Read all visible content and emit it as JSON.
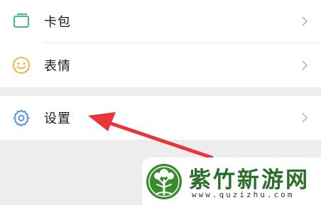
{
  "menu": {
    "items": [
      {
        "label": "卡包",
        "icon": "card-wallet-icon"
      },
      {
        "label": "表情",
        "icon": "smiley-icon"
      },
      {
        "label": "设置",
        "icon": "gear-icon"
      }
    ]
  },
  "annotation": {
    "arrow_color": "#e8353a",
    "points_to": "设置"
  },
  "watermark": {
    "title": "紫竹新游网",
    "url": "www.quzizhu.com",
    "logo_color": "#3a8a2e"
  },
  "colors": {
    "background": "#ededed",
    "row": "#ffffff",
    "card_icon": "#3fbf7a",
    "smiley_icon": "#f2b24a",
    "gear_icon": "#4a8fd8",
    "chevron": "#b8b8b8"
  }
}
